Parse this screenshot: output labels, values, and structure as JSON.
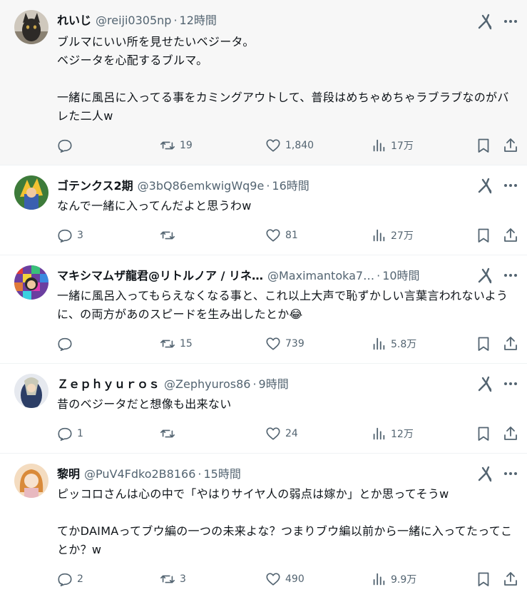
{
  "posts": [
    {
      "name": "れいじ",
      "handle": "@reiji0305np",
      "time": "12時間",
      "text": "ブルマにいい所を見せたいベジータ。\nベジータを心配するブルマ。\n\n一緒に風呂に入ってる事をカミングアウトして、普段はめちゃめちゃラブラブなのがバレた二人w",
      "replies": "",
      "reposts": "19",
      "likes": "1,840",
      "views": "17万"
    },
    {
      "name": "ゴテンクス2期",
      "handle": "@3bQ86emkwigWq9e",
      "time": "16時間",
      "text": "なんで一緒に入ってんだよと思うわw",
      "replies": "3",
      "reposts": "",
      "likes": "81",
      "views": "27万"
    },
    {
      "name": "マキシマムザ龍君@リトルノア / リネ…",
      "handle": "@Maximantoka7…",
      "time": "10時間",
      "text": "一緒に風呂入ってもらえなくなる事と、これ以上大声で恥ずかしい言葉言われないように、の両方があのスピードを生み出したとか😂",
      "replies": "",
      "reposts": "15",
      "likes": "739",
      "views": "5.8万"
    },
    {
      "name": "Ｚｅｐｈｙｕｒｏｓ",
      "handle": "@Zephyuros86",
      "time": "9時間",
      "text": "昔のベジータだと想像も出来ない",
      "replies": "1",
      "reposts": "",
      "likes": "24",
      "views": "12万"
    },
    {
      "name": "黎明",
      "handle": "@PuV4Fdko2B8166",
      "time": "15時間",
      "text": "ピッコロさんは心の中で「やはりサイヤ人の弱点は嫁か」とか思ってそうw\n\nてかDAIMAってブウ編の一つの未来よな？つまりブウ編以前から一緒に入ってたってことか？w",
      "replies": "2",
      "reposts": "3",
      "likes": "490",
      "views": "9.9万"
    }
  ],
  "separator": "·",
  "icons": [
    "grok-icon",
    "more-icon",
    "reply-icon",
    "repost-icon",
    "like-icon",
    "views-icon",
    "bookmark-icon",
    "share-icon"
  ],
  "colors": {
    "text": "#0f1419",
    "secondary": "#536471",
    "highlight_bg": "#f7f7f7",
    "divider": "#eff3f4"
  }
}
